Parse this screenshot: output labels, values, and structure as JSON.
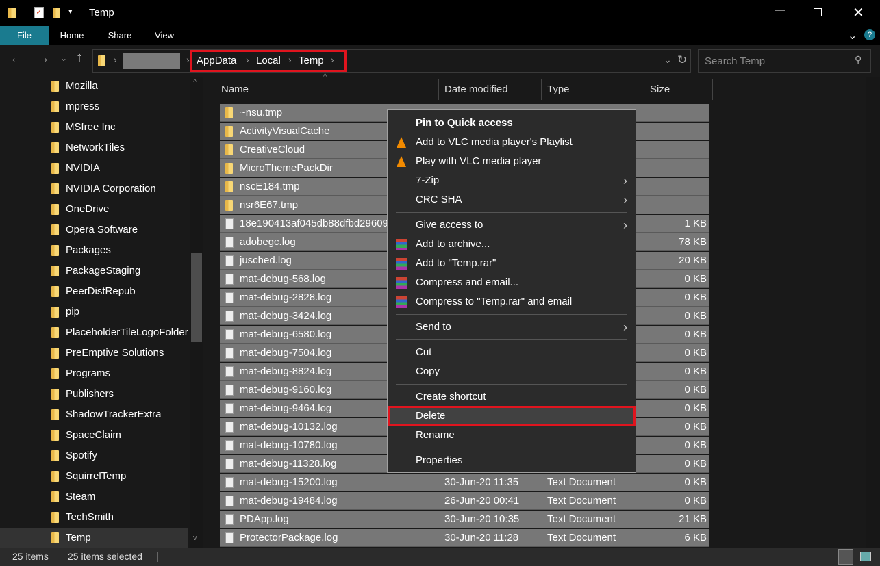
{
  "window": {
    "title": "Temp"
  },
  "ribbon": {
    "tabs": [
      "File",
      "Home",
      "Share",
      "View"
    ],
    "accent": "#1a7b8f"
  },
  "address": {
    "crumbs": [
      "AppData",
      "Local",
      "Temp"
    ],
    "search_placeholder": "Search Temp"
  },
  "sidebar": {
    "items": [
      "Mozilla",
      "mpress",
      "MSfree Inc",
      "NetworkTiles",
      "NVIDIA",
      "NVIDIA Corporation",
      "OneDrive",
      "Opera Software",
      "Packages",
      "PackageStaging",
      "PeerDistRepub",
      "pip",
      "PlaceholderTileLogoFolder",
      "PreEmptive Solutions",
      "Programs",
      "Publishers",
      "ShadowTrackerExtra",
      "SpaceClaim",
      "Spotify",
      "SquirrelTemp",
      "Steam",
      "TechSmith",
      "Temp"
    ],
    "selected": "Temp"
  },
  "columns": [
    "Name",
    "Date modified",
    "Type",
    "Size"
  ],
  "files": [
    {
      "name": "~nsu.tmp",
      "kind": "folder"
    },
    {
      "name": "ActivityVisualCache",
      "kind": "folder"
    },
    {
      "name": "CreativeCloud",
      "kind": "folder"
    },
    {
      "name": "MicroThemePackDir",
      "kind": "folder"
    },
    {
      "name": "nscE184.tmp",
      "kind": "folder"
    },
    {
      "name": "nsr6E67.tmp",
      "kind": "folder"
    },
    {
      "name": "18e190413af045db88dfbd29609",
      "kind": "file",
      "size": "1 KB"
    },
    {
      "name": "adobegc.log",
      "kind": "file",
      "size": "78 KB"
    },
    {
      "name": "jusched.log",
      "kind": "file",
      "size": "20 KB"
    },
    {
      "name": "mat-debug-568.log",
      "kind": "file",
      "size": "0 KB"
    },
    {
      "name": "mat-debug-2828.log",
      "kind": "file",
      "size": "0 KB"
    },
    {
      "name": "mat-debug-3424.log",
      "kind": "file",
      "size": "0 KB"
    },
    {
      "name": "mat-debug-6580.log",
      "kind": "file",
      "size": "0 KB"
    },
    {
      "name": "mat-debug-7504.log",
      "kind": "file",
      "size": "0 KB"
    },
    {
      "name": "mat-debug-8824.log",
      "kind": "file",
      "size": "0 KB"
    },
    {
      "name": "mat-debug-9160.log",
      "kind": "file",
      "size": "0 KB"
    },
    {
      "name": "mat-debug-9464.log",
      "kind": "file",
      "size": "0 KB"
    },
    {
      "name": "mat-debug-10132.log",
      "kind": "file",
      "size": "0 KB"
    },
    {
      "name": "mat-debug-10780.log",
      "kind": "file",
      "size": "0 KB"
    },
    {
      "name": "mat-debug-11328.log",
      "kind": "file",
      "size": "0 KB"
    },
    {
      "name": "mat-debug-15200.log",
      "kind": "file",
      "date": "30-Jun-20 11:35",
      "type": "Text Document",
      "size": "0 KB"
    },
    {
      "name": "mat-debug-19484.log",
      "kind": "file",
      "date": "26-Jun-20 00:41",
      "type": "Text Document",
      "size": "0 KB"
    },
    {
      "name": "PDApp.log",
      "kind": "file",
      "date": "30-Jun-20 10:35",
      "type": "Text Document",
      "size": "21 KB"
    },
    {
      "name": "ProtectorPackage.log",
      "kind": "file",
      "date": "30-Jun-20 11:28",
      "type": "Text Document",
      "size": "6 KB"
    }
  ],
  "context_menu": [
    {
      "label": "Pin to Quick access",
      "bold": true
    },
    {
      "label": "Add to VLC media player's Playlist",
      "icon": "vlc"
    },
    {
      "label": "Play with VLC media player",
      "icon": "vlc"
    },
    {
      "label": "7-Zip",
      "submenu": true
    },
    {
      "label": "CRC SHA",
      "submenu": true
    },
    {
      "sep": true
    },
    {
      "label": "Give access to",
      "submenu": true
    },
    {
      "label": "Add to archive...",
      "icon": "rar"
    },
    {
      "label": "Add to \"Temp.rar\"",
      "icon": "rar"
    },
    {
      "label": "Compress and email...",
      "icon": "rar"
    },
    {
      "label": "Compress to \"Temp.rar\" and email",
      "icon": "rar"
    },
    {
      "sep": true
    },
    {
      "label": "Send to",
      "submenu": true
    },
    {
      "sep": true
    },
    {
      "label": "Cut"
    },
    {
      "label": "Copy"
    },
    {
      "sep": true
    },
    {
      "label": "Create shortcut"
    },
    {
      "label": "Delete",
      "highlighted": true
    },
    {
      "label": "Rename"
    },
    {
      "sep": true
    },
    {
      "label": "Properties"
    }
  ],
  "status": {
    "count": "25 items",
    "selected": "25 items selected"
  }
}
